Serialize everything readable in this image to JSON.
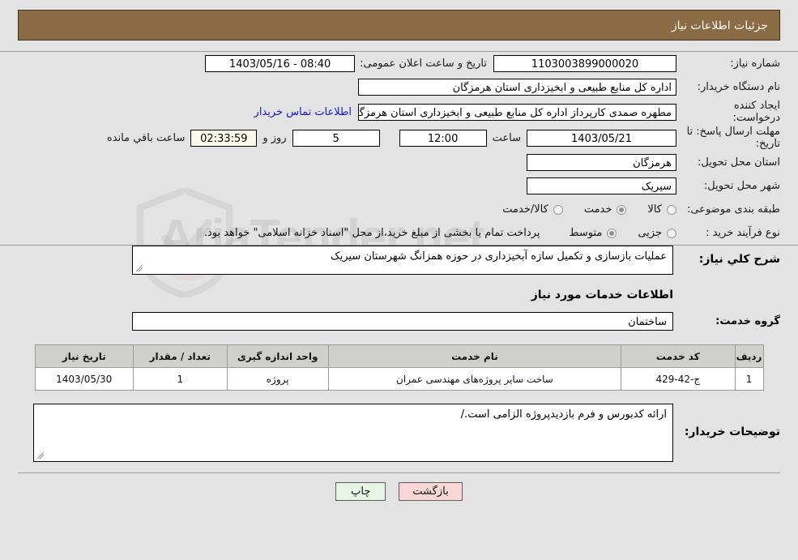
{
  "header": {
    "title": "جزئیات اطلاعات نیاز"
  },
  "form": {
    "need_number": {
      "label": "شماره نیاز:",
      "value": "1103003899000020"
    },
    "announcement": {
      "label": "تاریخ و ساعت اعلان عمومی:",
      "value": "08:40 - 1403/05/16"
    },
    "buyer_org": {
      "label": "نام دستگاه خریدار:",
      "value": "اداره کل منابع طبیعی و ابخیزداری استان هرمزگان"
    },
    "creator": {
      "label": "ایجاد کننده درخواست:",
      "value": "مطهره صمدی کارپرداز اداره کل منابع طبیعی و ابخیزداری استان هرمزگان"
    },
    "contact_link": "اطلاعات تماس خریدار",
    "deadline": {
      "label": "مهلت ارسال پاسخ: تا تاریخ:",
      "date": "1403/05/21",
      "hour_label": "ساعت",
      "hour": "12:00",
      "days": "5",
      "days_label": "روز و",
      "timer": "02:33:59",
      "remaining_label": "ساعت باقي مانده"
    },
    "province": {
      "label": "استان محل تحویل:",
      "value": "هرمزگان"
    },
    "city": {
      "label": "شهر محل تحویل:",
      "value": "سیریک"
    },
    "category": {
      "label": "طبقه بندی موضوعی:",
      "options": [
        {
          "label": "کالا",
          "selected": false
        },
        {
          "label": "خدمت",
          "selected": true
        },
        {
          "label": "کالا/خدمت",
          "selected": false
        }
      ]
    },
    "purchase_type": {
      "label": "نوع فرآیند خرید :",
      "options": [
        {
          "label": "جزیی",
          "selected": false
        },
        {
          "label": "متوسط",
          "selected": true
        }
      ],
      "note": "پرداخت تمام یا بخشی از مبلغ خرید،از محل \"اسناد خزانه اسلامی\" خواهد بود."
    }
  },
  "main": {
    "general_desc": {
      "label": "شرح کلي نیاز:",
      "value": "عملیات بازسازی و تکمیل سازه آبخیزداری در حوزه همزانگ شهرستان سیریک"
    },
    "services_section_title": "اطلاعات خدمات مورد نیاز",
    "service_group": {
      "label": "گروه خدمت:",
      "value": "ساختمان"
    },
    "table": {
      "columns": [
        "ردیف",
        "کد خدمت",
        "نام خدمت",
        "واحد اندازه گیری",
        "تعداد / مقدار",
        "تاریخ نیاز"
      ],
      "rows": [
        [
          "1",
          "ج-42-429",
          "ساخت سایر پروژه‌های مهندسی عمران",
          "پروژه",
          "1",
          "1403/05/30"
        ]
      ]
    },
    "buyer_notes": {
      "label": "توضیحات خریدار:",
      "value": "ارائه کدبورس و فرم بازدیدپروژه الزامی است./"
    }
  },
  "footer": {
    "print_button": "چاپ",
    "back_button": "بازگشت"
  },
  "watermark": {
    "text": "AriaTender.net"
  },
  "colors": {
    "header_bg": "#8b6b43",
    "page_bg": "#e3e3e3",
    "link": "#1414d2",
    "print_btn": "#e6f5e6",
    "back_btn": "#f9d7d7",
    "table_header": "#cfcfcb"
  }
}
